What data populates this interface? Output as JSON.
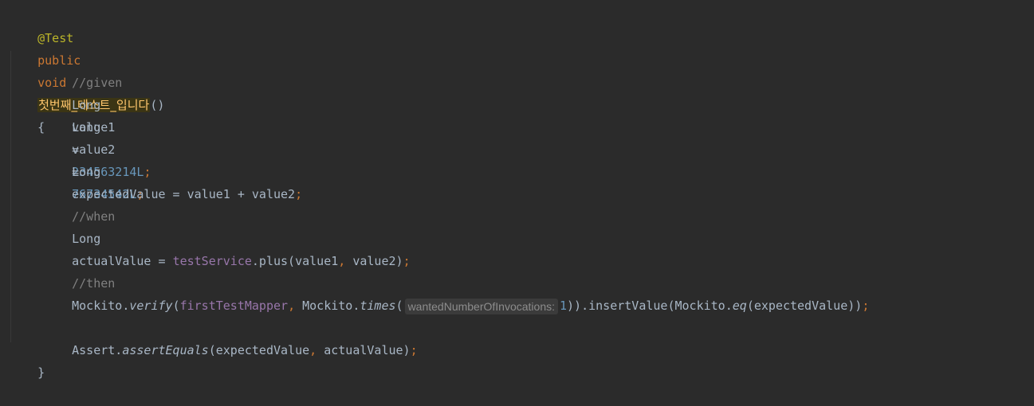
{
  "code": {
    "annotation": "@Test",
    "signature": {
      "modifier": "public",
      "return_type": "void",
      "method_name": "첫번째_테스트_입니다",
      "params": "()",
      "open_brace": "{"
    },
    "comment_given": "//given",
    "line_value1": {
      "type": "Long",
      "name": "value1",
      "op": "=",
      "literal": "234563214L",
      "semicolon": ";"
    },
    "line_value2": {
      "type": "Long",
      "name": "value2",
      "op": "=",
      "literal": "76734542L",
      "semicolon": ";"
    },
    "line_expected": {
      "type": "Long",
      "text": "expectedValue = value1 + value2",
      "semicolon": ";"
    },
    "comment_when": "//when",
    "line_actual": {
      "type": "Long",
      "lhs": "actualValue = ",
      "field": "testService",
      "call": ".plus(value1",
      "comma": ",",
      "rest": " value2)",
      "semicolon": ";"
    },
    "comment_then": "//then",
    "line_verify": {
      "obj": "Mockito.",
      "verify": "verify",
      "open": "(",
      "field": "firstTestMapper",
      "comma": ",",
      "mockito2": " Mockito.",
      "times": "times",
      "open2": "(",
      "hint_label": "wantedNumberOfInvocations:",
      "hint_value": "1",
      "mid": ")).insertValue(Mockito.",
      "eq": "eq",
      "tail": "(expectedValue))",
      "semicolon": ";"
    },
    "line_assert": {
      "obj": "Assert.",
      "method": "assertEquals",
      "args1": "(expectedValue",
      "comma": ",",
      "args2": " actualValue)",
      "semicolon": ";"
    },
    "close_brace": "}"
  }
}
